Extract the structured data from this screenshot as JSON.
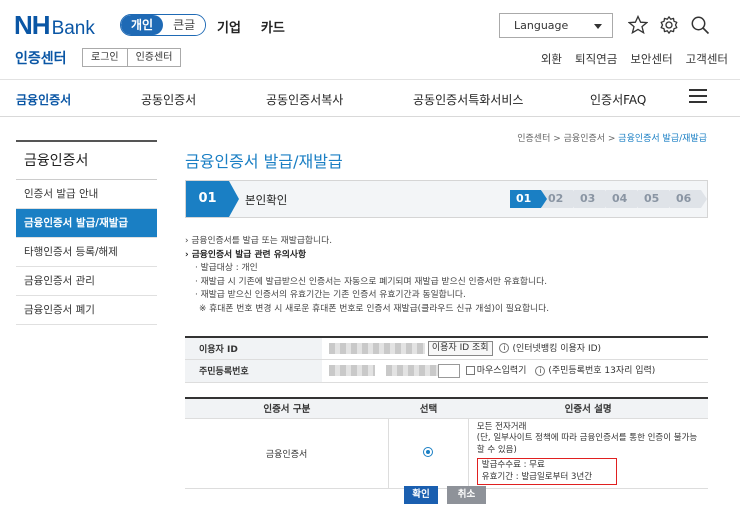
{
  "header": {
    "logo_nh": "NH",
    "logo_bank": "Bank",
    "mode_personal": "개인",
    "mode_large": "큰글",
    "nav": [
      "기업",
      "카드"
    ],
    "language": "Language",
    "cert_center": "인증센터",
    "login": "로그인",
    "cert_center_link": "인증센터",
    "util": [
      "외환",
      "퇴직연금",
      "보안센터",
      "고객센터"
    ]
  },
  "gnb": {
    "items": [
      "금융인증서",
      "공동인증서",
      "공동인증서복사",
      "공동인증서특화서비스",
      "인증서FAQ"
    ]
  },
  "lnb": {
    "title": "금융인증서",
    "items": [
      "인증서 발급 안내",
      "금융인증서 발급/재발급",
      "타행인증서 등록/해제",
      "금융인증서 관리",
      "금융인증서 폐기"
    ]
  },
  "breadcrumb": {
    "path": "인증센터 > 금융인증서 > ",
    "current": "금융인증서 발급/재발급"
  },
  "page_title": "금융인증서 발급/재발급",
  "steps": {
    "current_num": "01",
    "current_label": "본인확인",
    "list": [
      "01",
      "02",
      "03",
      "04",
      "05",
      "06"
    ]
  },
  "notes": {
    "line1": "› 금융인증서를 발급 또는 재발급합니다.",
    "heading": "› 금융인증서 발급 관련 유의사항",
    "line2": "· 발급대상 : 개인",
    "line3": "· 재발급 시 기존에 발급받으신 인증서는 자동으로 폐기되며 재발급 받으신 인증서만 유효합니다.",
    "line4": "· 재발급 받으신 인증서의 유효기간는 기존 인증서 유효기간과 동일합니다.",
    "line5": "※ 휴대폰 번호 변경 시 새로운 휴대폰 번호로 인증서 재발급(클라우드 신규 개설)이 필요합니다."
  },
  "form": {
    "user_id_label": "이용자 ID",
    "user_id_lookup": "이용자 ID 조회",
    "user_id_hint": "(인터넷뱅킹 이용자 ID)",
    "rrn_label": "주민등록번호",
    "mask_input": "마우스입력기",
    "rrn_hint": "(주민등록번호 13자리 입력)"
  },
  "cert_table": {
    "headers": [
      "인증서 구분",
      "선택",
      "인증서 설명"
    ],
    "row_type": "금융인증서",
    "desc1": "모든 전자거래",
    "desc2": "(단, 일부사이트 정책에 따라 금융인증서를 통한 인증이 불가능할 수 있음)",
    "fee": "발급수수료 : 무료",
    "validity": "유효기간 : 발급일로부터 3년간"
  },
  "buttons": {
    "confirm": "확인",
    "cancel": "취소"
  },
  "colors": {
    "brand": "#0a56a5",
    "accent": "#1a7fc4",
    "highlight_border": "#e02020"
  }
}
